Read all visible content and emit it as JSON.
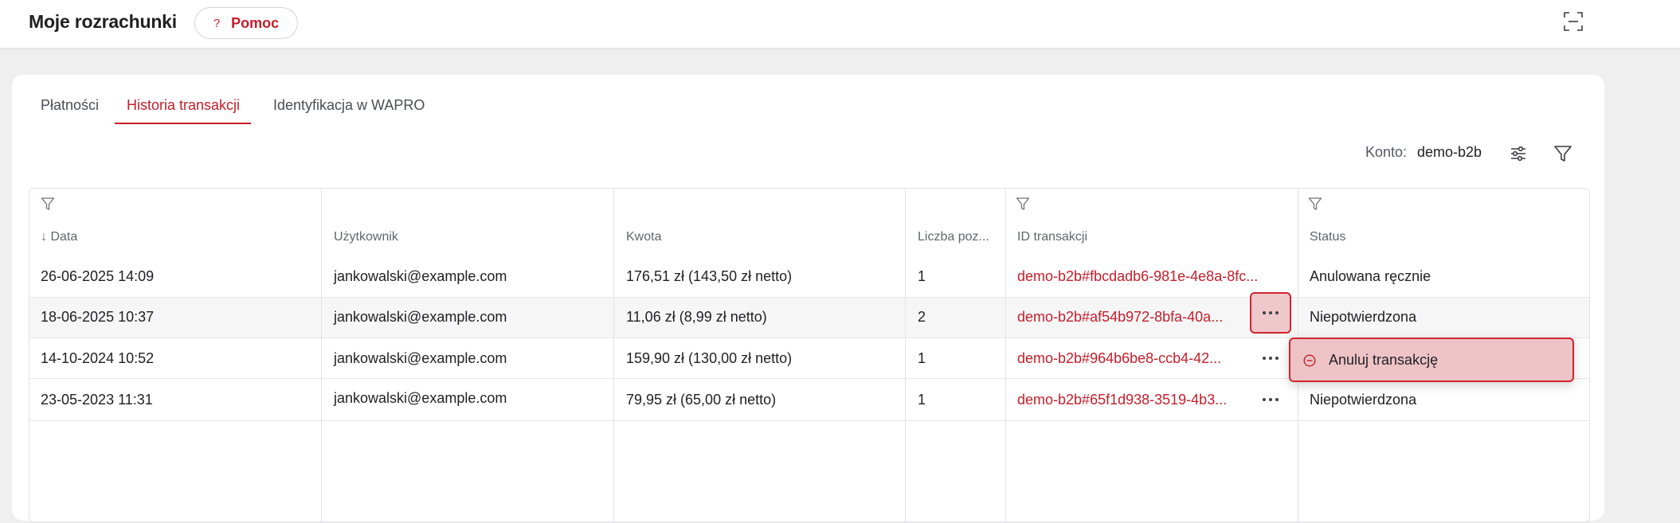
{
  "header": {
    "title": "Moje rozrachunki",
    "help_label": "Pomoc",
    "help_icon": "?"
  },
  "tabs": [
    {
      "label": "Płatności",
      "active": false
    },
    {
      "label": "Historia transakcji",
      "active": true
    },
    {
      "label": "Identyfikacja w WAPRO",
      "active": false
    }
  ],
  "toolbar": {
    "account_label": "Konto:",
    "account_value": "demo-b2b"
  },
  "table": {
    "columns": [
      "Data",
      "Użytkownik",
      "Kwota",
      "Liczba poz...",
      "ID transakcji",
      "Status"
    ],
    "sort_indicator": "↓",
    "rows": [
      {
        "date": "26-06-2025 14:09",
        "user": "jankowalski@example.com",
        "amount": "176,51 zł (143,50 zł netto)",
        "count": "1",
        "id": "demo-b2b#fbcdadb6-981e-4e8a-8fc...",
        "status": "Anulowana ręcznie"
      },
      {
        "date": "18-06-2025 10:37",
        "user": "jankowalski@example.com",
        "amount": "11,06 zł (8,99 zł netto)",
        "count": "2",
        "id": "demo-b2b#af54b972-8bfa-40a...",
        "status": "Niepotwierdzona"
      },
      {
        "date": "14-10-2024 10:52",
        "user": "jankowalski@example.com",
        "amount": "159,90 zł (130,00 zł netto)",
        "count": "1",
        "id": "demo-b2b#964b6be8-ccb4-42...",
        "status": ""
      },
      {
        "date": "23-05-2023 11:31",
        "user": "jankowalski@example.com",
        "amount": "79,95 zł (65,00 zł netto)",
        "count": "1",
        "id": "demo-b2b#65f1d938-3519-4b3...",
        "status": "Niepotwierdzona"
      }
    ]
  },
  "context_menu": {
    "items": [
      {
        "label": "Anuluj transakcję",
        "icon": "minus-circle-icon"
      }
    ]
  },
  "colors": {
    "accent": "#c41e2a",
    "highlight_bg": "#edc3c6",
    "highlight_border": "#d3232f"
  }
}
